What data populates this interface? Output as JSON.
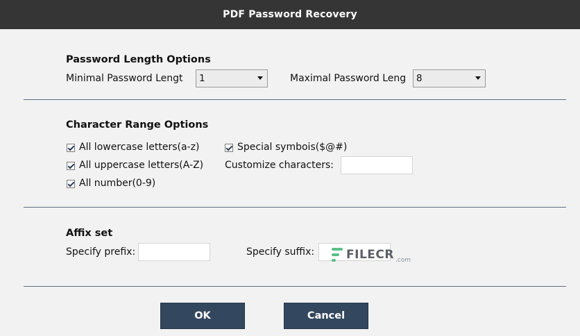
{
  "window": {
    "title": "PDF Password Recovery"
  },
  "password_length": {
    "heading": "Password Length Options",
    "min_label": "Minimal Password Lengt",
    "min_value": "1",
    "max_label": "Maximal Password Leng",
    "max_value": "8"
  },
  "character_range": {
    "heading": "Character Range Options",
    "lowercase_label": "All lowercase letters(a-z)",
    "uppercase_label": "All uppercase letters(A-Z)",
    "number_label": "All number(0-9)",
    "special_label": "Special symbois($@#)",
    "customize_label": "Customize characters:",
    "customize_value": "",
    "lowercase_checked": true,
    "uppercase_checked": true,
    "number_checked": true,
    "special_checked": true
  },
  "affix": {
    "heading": "Affix set",
    "prefix_label": "Specify prefix:",
    "prefix_value": "",
    "suffix_label": "Specify suffix:",
    "suffix_value": ""
  },
  "buttons": {
    "ok": "OK",
    "cancel": "Cancel"
  },
  "watermark": {
    "brand": "FILECR",
    "suffix": ".com"
  },
  "colors": {
    "titlebar": "#353535",
    "button": "#33475e",
    "divider": "#5e6f82",
    "background": "#f2f2f2"
  }
}
